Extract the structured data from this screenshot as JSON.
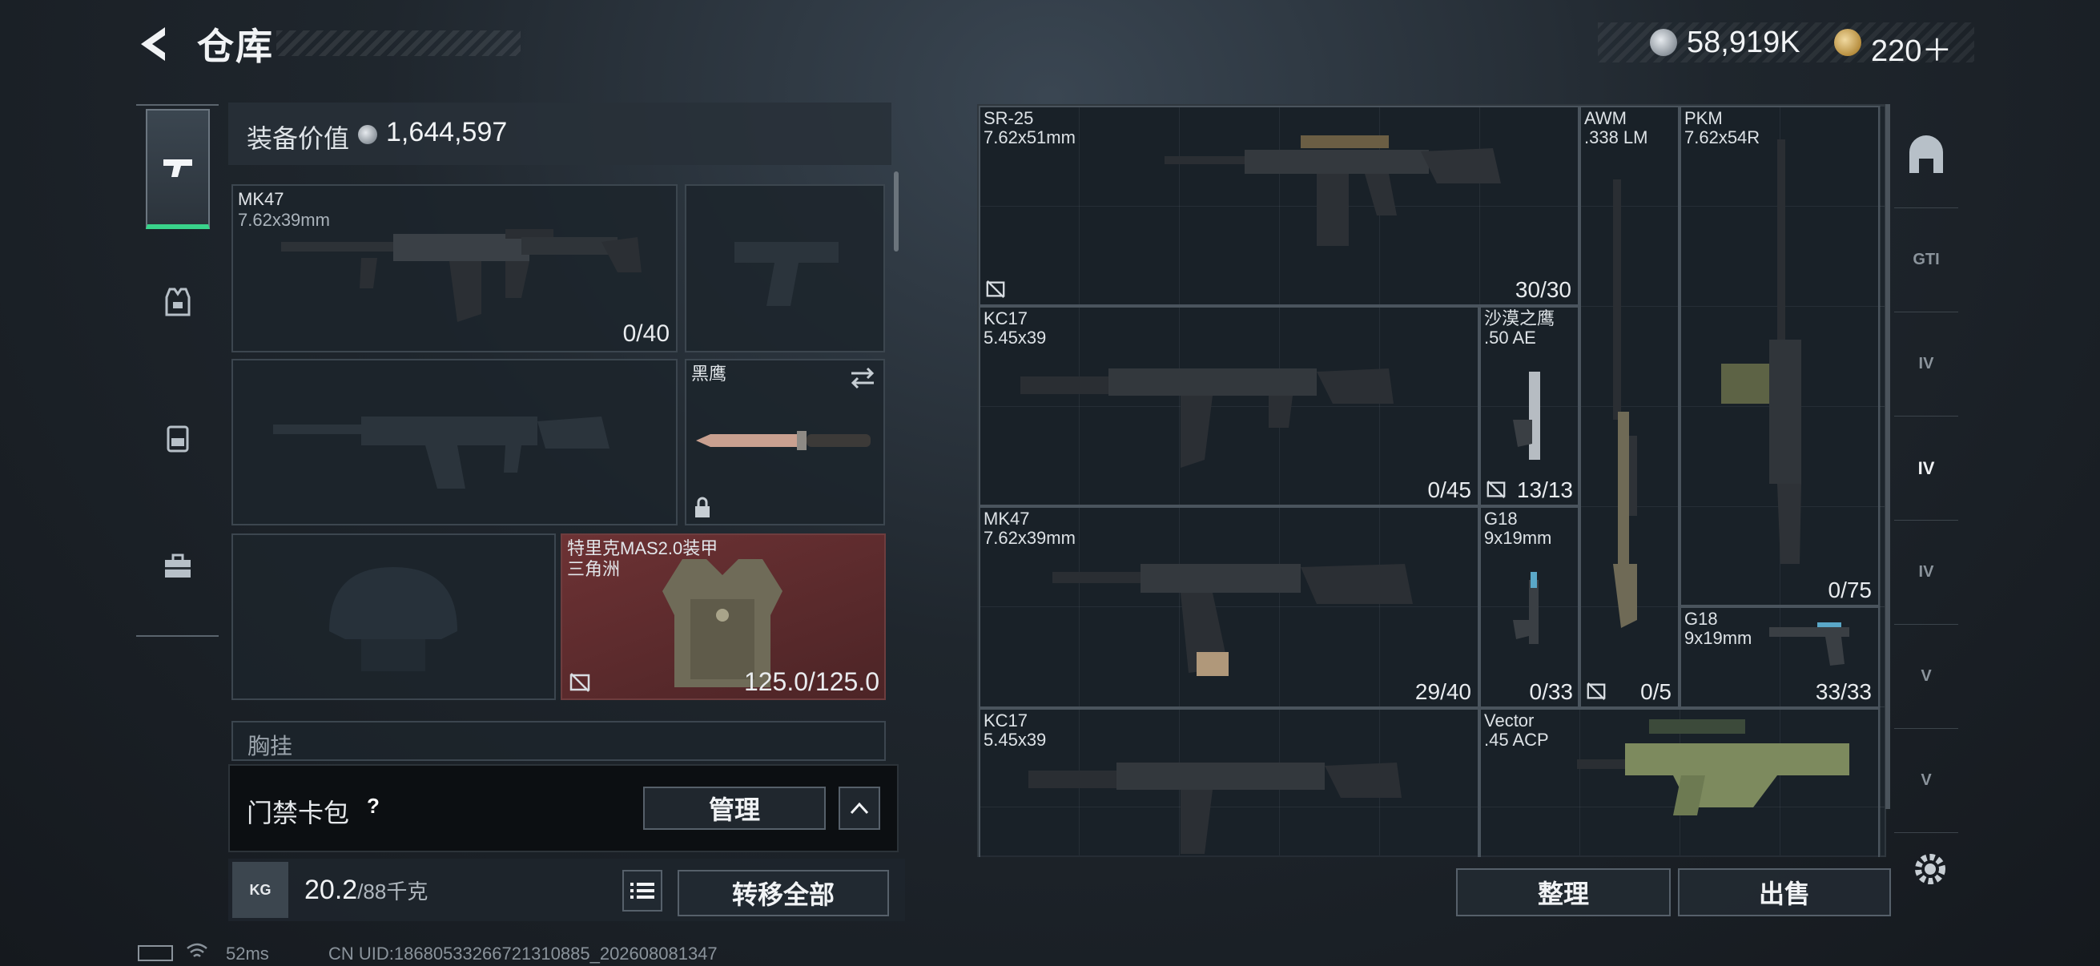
{
  "header": {
    "title": "仓库",
    "currency_silver": "58,919K",
    "currency_gold": "220＋"
  },
  "loadout": {
    "value_label": "装备价值",
    "value": "1,644,597",
    "primary": {
      "name": "MK47",
      "caliber": "7.62x39mm",
      "ammo": "0/40"
    },
    "melee": {
      "name": "黑鹰"
    },
    "armor": {
      "name": "特里克MAS2.0装甲",
      "sub": "三角洲",
      "durability": "125.0/125.0"
    },
    "chest_label": "胸挂",
    "card_pack": {
      "label": "门禁卡包",
      "help": "?",
      "manage": "管理"
    },
    "weight": {
      "value": "20.2",
      "max": "/88千克",
      "kg_label": "KG"
    },
    "transfer_all": "转移全部"
  },
  "storage": {
    "items": [
      {
        "name": "SR-25",
        "caliber": "7.62x51mm",
        "count": "30/30"
      },
      {
        "name": "AWM",
        "caliber": ".338 LM",
        "count": "0/5"
      },
      {
        "name": "PKM",
        "caliber": "7.62x54R",
        "count": "0/75"
      },
      {
        "name": "KC17",
        "caliber": "5.45x39",
        "count": "0/45"
      },
      {
        "name": "沙漠之鹰",
        "caliber": ".50 AE",
        "count": "13/13"
      },
      {
        "name": "MK47",
        "caliber": "7.62x39mm",
        "count": "29/40"
      },
      {
        "name": "G18",
        "caliber": "9x19mm",
        "count": "0/33"
      },
      {
        "name": "G18",
        "caliber": "9x19mm",
        "count": "33/33"
      },
      {
        "name": "KC17",
        "caliber": "5.45x39",
        "count": ""
      },
      {
        "name": "Vector",
        "caliber": ".45 ACP",
        "count": ""
      }
    ],
    "sort_button": "整理",
    "sell_button": "出售"
  },
  "right_nav": [
    "GTI",
    "IV",
    "IV",
    "IV",
    "V",
    "V"
  ],
  "status": {
    "ping": "52ms",
    "uid": "CN UID:1868053326672131088​5_202608081347"
  },
  "colors": {
    "accent_green": "#39d38b",
    "armor_red": "#6d3234"
  }
}
